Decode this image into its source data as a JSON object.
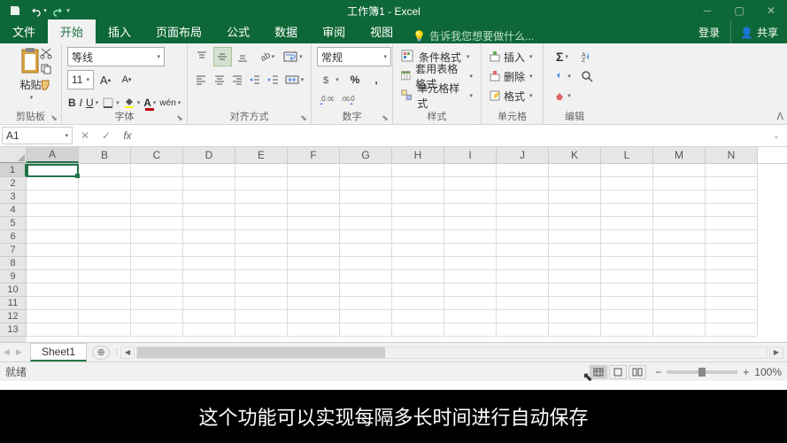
{
  "title": "工作簿1 - Excel",
  "tabs": {
    "file": "文件",
    "home": "开始",
    "insert": "插入",
    "layout": "页面布局",
    "formulas": "公式",
    "data": "数据",
    "review": "审阅",
    "view": "视图"
  },
  "tell_me": "告诉我您想要做什么...",
  "login": "登录",
  "share": "共享",
  "ribbon": {
    "clipboard": {
      "paste": "粘贴",
      "label": "剪贴板"
    },
    "font": {
      "name": "等线",
      "size": "11",
      "label": "字体"
    },
    "align": {
      "label": "对齐方式"
    },
    "number": {
      "format": "常规",
      "label": "数字"
    },
    "styles": {
      "cond": "条件格式",
      "table": "套用表格格式",
      "cell": "单元格样式",
      "label": "样式"
    },
    "cells": {
      "insert": "插入",
      "delete": "删除",
      "format": "格式",
      "label": "单元格"
    },
    "edit": {
      "label": "编辑"
    }
  },
  "name_box": "A1",
  "columns": [
    "A",
    "B",
    "C",
    "D",
    "E",
    "F",
    "G",
    "H",
    "I",
    "J",
    "K",
    "L",
    "M",
    "N"
  ],
  "rows": [
    1,
    2,
    3,
    4,
    5,
    6,
    7,
    8,
    9,
    10,
    11,
    12,
    13
  ],
  "sheet": "Sheet1",
  "status": "就绪",
  "zoom": "100%",
  "subtitle": "这个功能可以实现每隔多长时间进行自动保存"
}
